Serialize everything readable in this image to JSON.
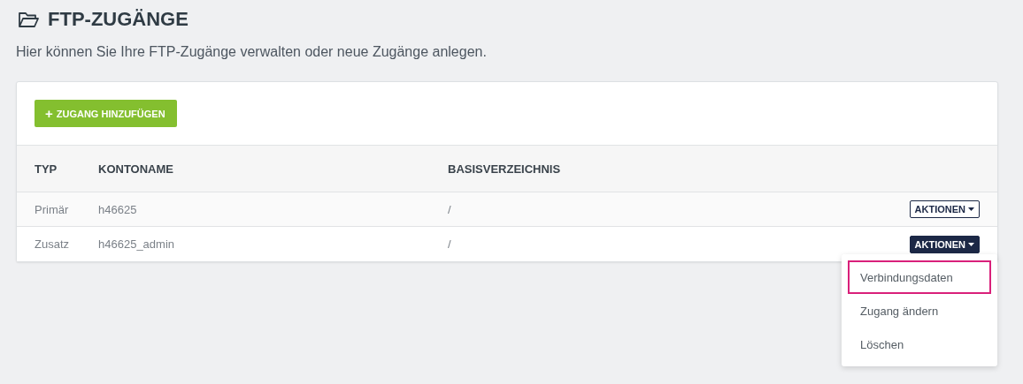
{
  "page": {
    "title": "FTP-ZUGÄNGE",
    "subtitle": "Hier können Sie Ihre FTP-Zugänge verwalten oder neue Zugänge anlegen."
  },
  "add_button": {
    "icon": "+",
    "label": "ZUGANG HINZUFÜGEN"
  },
  "table": {
    "columns": [
      "TYP",
      "KONTONAME",
      "BASISVERZEICHNIS"
    ],
    "rows": [
      {
        "typ": "Primär",
        "kontoname": "h46625",
        "basisverzeichnis": "/",
        "action": "AKTIONEN",
        "open": false
      },
      {
        "typ": "Zusatz",
        "kontoname": "h46625_admin",
        "basisverzeichnis": "/",
        "action": "AKTIONEN",
        "open": true
      }
    ]
  },
  "menu": {
    "items": [
      {
        "label": "Verbindungsdaten",
        "selected": true
      },
      {
        "label": "Zugang ändern",
        "selected": false
      },
      {
        "label": "Löschen",
        "selected": false
      }
    ]
  }
}
